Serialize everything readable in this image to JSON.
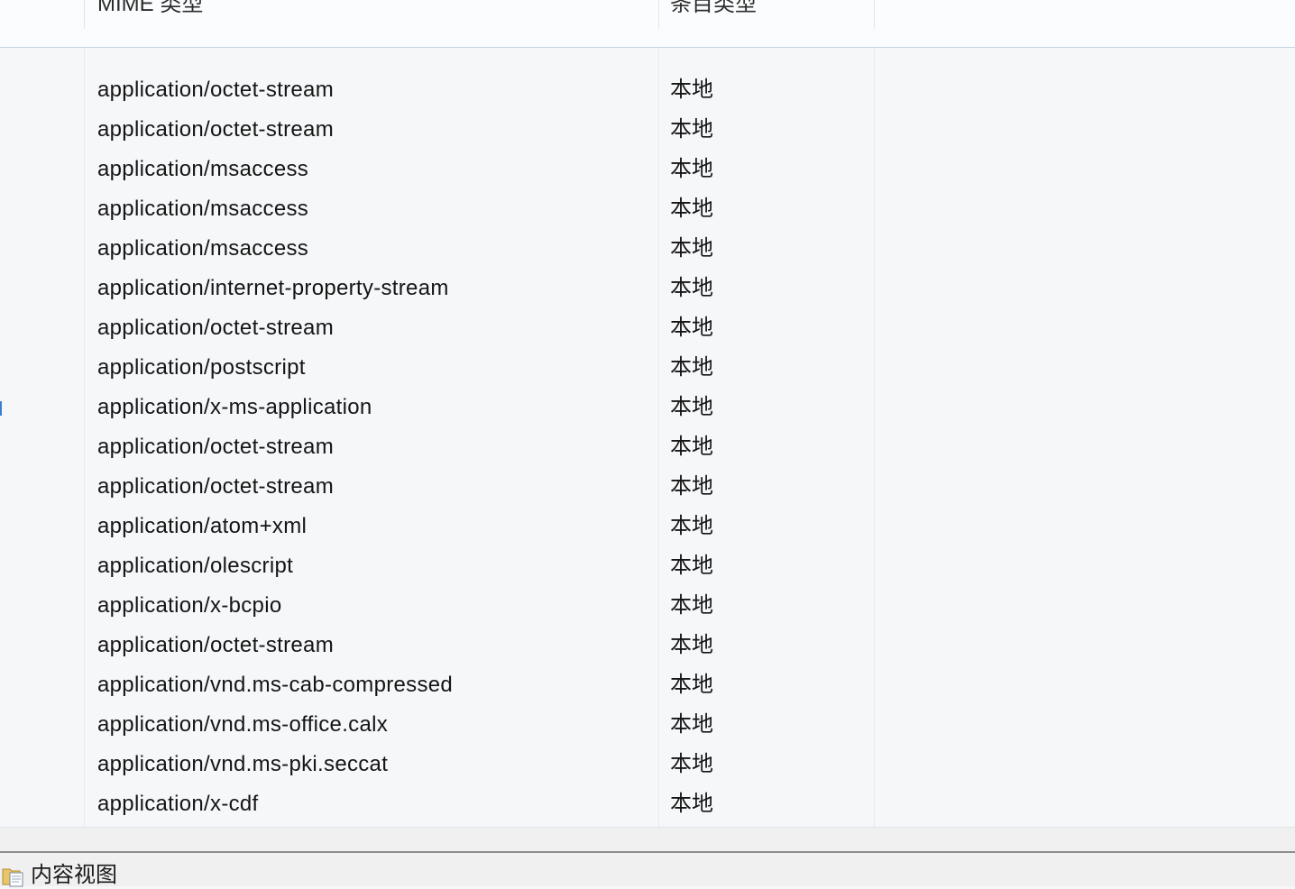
{
  "columns": {
    "mime_type": "MIME 类型",
    "entry_type": "条目类型"
  },
  "rows": [
    {
      "mime": "application/octet-stream",
      "type": "本地"
    },
    {
      "mime": "application/octet-stream",
      "type": "本地"
    },
    {
      "mime": "application/msaccess",
      "type": "本地"
    },
    {
      "mime": "application/msaccess",
      "type": "本地"
    },
    {
      "mime": "application/msaccess",
      "type": "本地"
    },
    {
      "mime": "application/internet-property-stream",
      "type": "本地"
    },
    {
      "mime": "application/octet-stream",
      "type": "本地"
    },
    {
      "mime": "application/postscript",
      "type": "本地"
    },
    {
      "mime": "application/x-ms-application",
      "type": "本地"
    },
    {
      "mime": "application/octet-stream",
      "type": "本地"
    },
    {
      "mime": "application/octet-stream",
      "type": "本地"
    },
    {
      "mime": "application/atom+xml",
      "type": "本地"
    },
    {
      "mime": "application/olescript",
      "type": "本地"
    },
    {
      "mime": "application/x-bcpio",
      "type": "本地"
    },
    {
      "mime": "application/octet-stream",
      "type": "本地"
    },
    {
      "mime": "application/vnd.ms-cab-compressed",
      "type": "本地"
    },
    {
      "mime": "application/vnd.ms-office.calx",
      "type": "本地"
    },
    {
      "mime": "application/vnd.ms-pki.seccat",
      "type": "本地"
    },
    {
      "mime": "application/x-cdf",
      "type": "本地"
    }
  ],
  "bottom_bar": {
    "content_view_label": "内容视图",
    "content_view_icon": "folder-document-icon"
  },
  "colors": {
    "header_border": "#c6d4e8",
    "list_background": "#f6f7f9",
    "column_line": "#e7ebf0",
    "status_background": "#f0f0f0"
  }
}
